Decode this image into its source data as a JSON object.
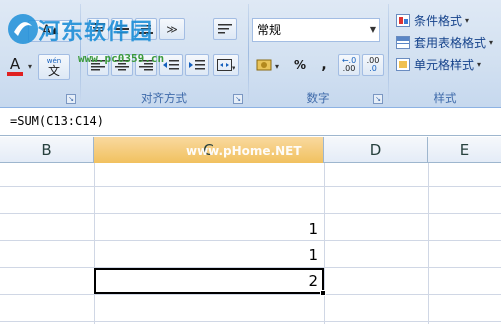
{
  "ribbon": {
    "alignment_group_label": "对齐方式",
    "number_group_label": "数字",
    "styles_group_label": "样式",
    "number_format_value": "常规",
    "percent_symbol": "%",
    "comma_symbol": ",",
    "increase_decimal_label": ".00",
    "decrease_decimal_label": ".0",
    "conditional_format_label": "条件格式",
    "table_format_label": "套用表格格式",
    "cell_styles_label": "单元格样式",
    "font_letter": "A",
    "wen_label": "wén",
    "wen_char": "文"
  },
  "watermark": {
    "site_name": "河东软件园",
    "url": "www.pc0359.cn",
    "column_watermark": "www.pHome.NET"
  },
  "formula_bar": {
    "formula": "=SUM(C13:C14)"
  },
  "grid": {
    "columns": [
      "B",
      "C",
      "D",
      "E"
    ],
    "active_column": "C",
    "values": [
      "1",
      "1",
      "2"
    ]
  },
  "colors": {
    "ribbon_bg": "#d3e1f1",
    "active_header": "#f1c15f",
    "gridline": "#d0d7e5",
    "label_blue": "#15428b"
  }
}
